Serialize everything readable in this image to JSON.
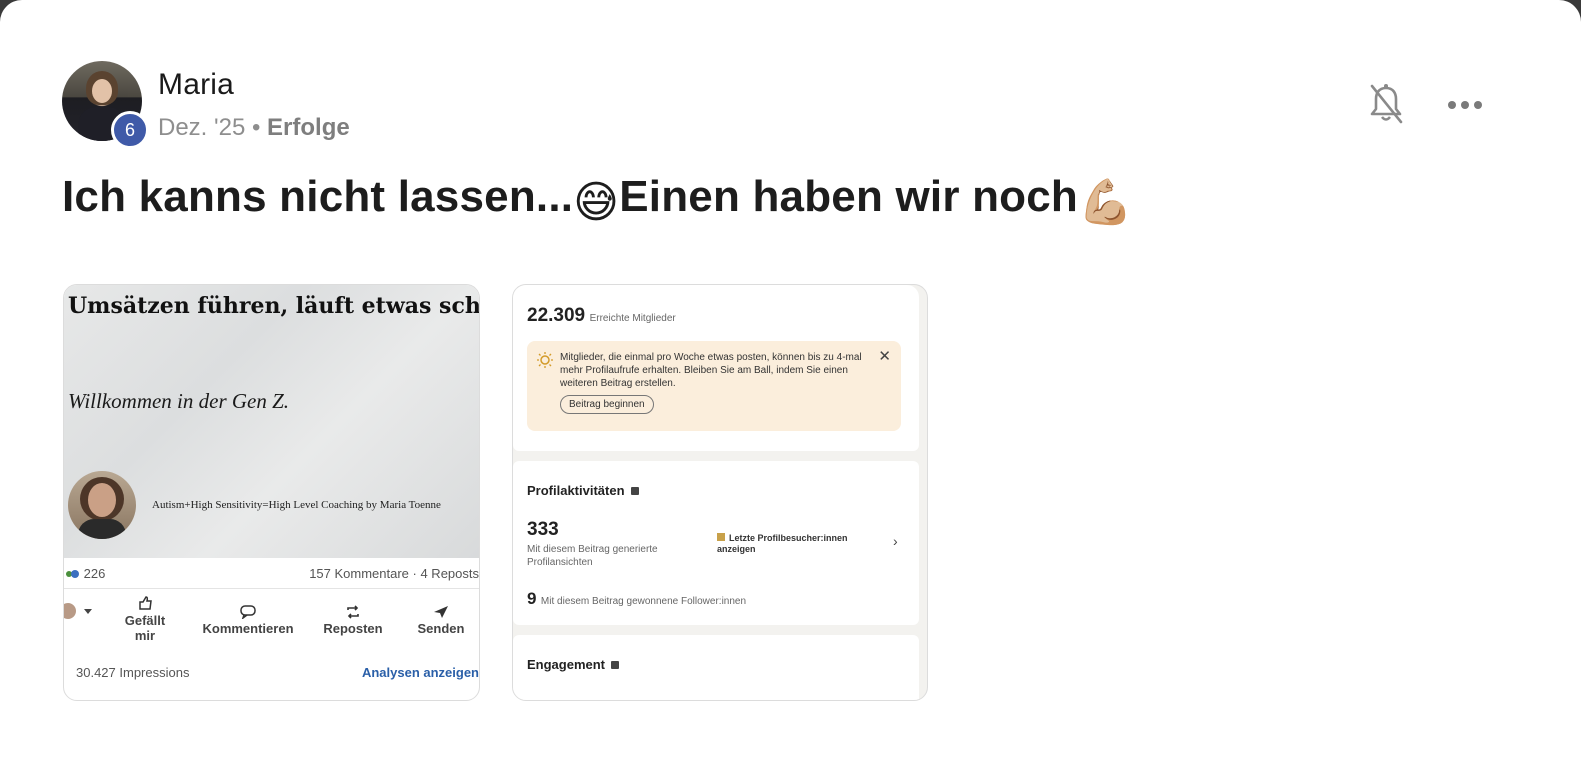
{
  "post": {
    "author": "Maria",
    "level": "6",
    "date": "Dez. '25",
    "separator": "•",
    "category": "Erfolge",
    "title_part1": "Ich kanns nicht lassen...",
    "title_emoji1": "😅",
    "title_part2": "Einen haben wir noch",
    "title_emoji2": "💪🏼",
    "icons": [
      "bell-muted-icon",
      "more-options-icon"
    ]
  },
  "image1": {
    "heading": "Umsätzen führen, läuft etwas schief.",
    "subheading": "Willkommen in der Gen Z.",
    "tagline": "Autism+High Sensitivity=High Level Coaching by Maria Toenne",
    "reactions_count": "226",
    "comments_reposts": "157 Kommentare · 4 Reposts",
    "actions": {
      "like": "Gefällt mir",
      "comment": "Kommentieren",
      "repost": "Reposten",
      "send": "Senden"
    },
    "impressions": "30.427 Impressions",
    "analytics_link": "Analysen anzeigen"
  },
  "image2": {
    "reach_value": "22.309",
    "reach_label": "Erreichte Mitglieder",
    "notice_text": "Mitglieder, die einmal pro Woche etwas posten, können bis zu 4-mal mehr Profilaufrufe erhalten. Bleiben Sie am Ball, indem Sie einen weiteren Beitrag erstellen.",
    "notice_button": "Beitrag beginnen",
    "notice_close": "✕",
    "profile_heading": "Profilaktivitäten",
    "profile_views_value": "333",
    "profile_views_label": "Mit diesem Beitrag generierte Profilansichten",
    "visitors_link": "Letzte Profilbesucher:innen anzeigen",
    "chevron": "›",
    "followers_value": "9",
    "followers_label": "Mit diesem Beitrag gewonnene Follower:innen",
    "engagement_heading": "Engagement"
  },
  "colors": {
    "level_badge": "#3f5aa8",
    "notice_bg": "#fbeedc",
    "link_blue": "#2a5fa8"
  }
}
